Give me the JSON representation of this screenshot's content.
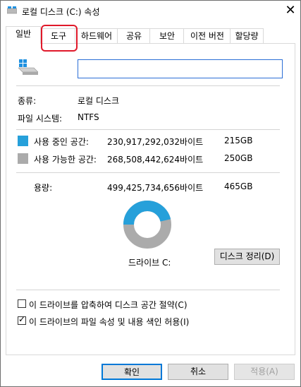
{
  "window": {
    "title": "로컬 디스크 (C:) 속성",
    "close_label": "✕"
  },
  "tabs": [
    {
      "label": "일반",
      "active": true
    },
    {
      "label": "도구",
      "active": false
    },
    {
      "label": "하드웨어",
      "active": false
    },
    {
      "label": "공유",
      "active": false
    },
    {
      "label": "보안",
      "active": false
    },
    {
      "label": "이전 버전",
      "active": false
    },
    {
      "label": "할당량",
      "active": false
    }
  ],
  "general": {
    "name_value": "",
    "type_label": "종류:",
    "type_value": "로컬 디스크",
    "fs_label": "파일 시스템:",
    "fs_value": "NTFS",
    "used_label": "사용 중인 공간:",
    "used_bytes": "230,917,292,032바이트",
    "used_gb": "215GB",
    "free_label": "사용 가능한 공간:",
    "free_bytes": "268,508,442,624바이트",
    "free_gb": "250GB",
    "capacity_label": "용량:",
    "capacity_bytes": "499,425,734,656바이트",
    "capacity_gb": "465GB",
    "drive_label": "드라이브 C:",
    "cleanup_button": "디스크 정리(D)",
    "used_fraction": 0.4624
  },
  "options": {
    "compress_label": "이 드라이브를 압축하여 디스크 공간 절약(C)",
    "compress_checked": false,
    "index_label": "이 드라이브의 파일 속성 및 내용 색인 허용(I)",
    "index_checked": true
  },
  "buttons": {
    "ok": "확인",
    "cancel": "취소",
    "apply": "적용(A)"
  },
  "colors": {
    "used": "#26a0da",
    "free": "#ababab",
    "highlight": "#e0192a",
    "accent": "#0078d7"
  }
}
